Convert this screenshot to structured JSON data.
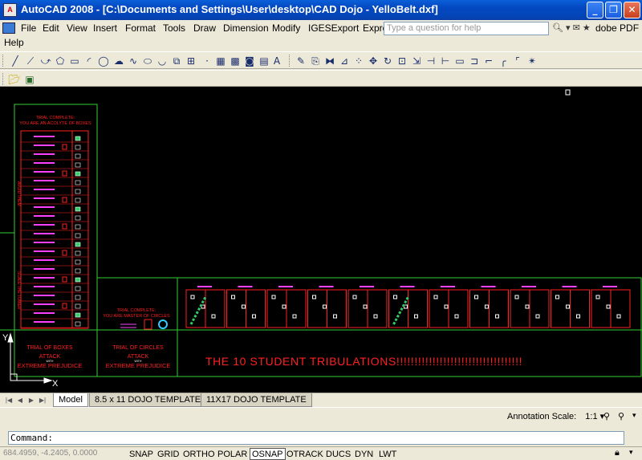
{
  "window": {
    "app_icon": "autocad-icon",
    "title": "AutoCAD 2008 - [C:\\Documents and Settings\\User\\desktop\\CAD Dojo - YelloBelt.dxf]",
    "minimize_icon": "minimize-icon",
    "restore_icon": "restore-icon",
    "close_icon": "close-icon"
  },
  "menu": {
    "items": [
      "File",
      "Edit",
      "View",
      "Insert",
      "Format",
      "Tools",
      "Draw",
      "Dimension",
      "Modify",
      "IGESExport",
      "Expre"
    ],
    "help": "Help",
    "ask_placeholder": "Type a question for help",
    "adobe_pdf": "dobe PDF"
  },
  "canvas": {
    "tribulations": "THE 10 STUDENT TRIBULATIONS!!!!!!!!!!!!!!!!!!!!!!!!!!!!!!!!!!!",
    "trial_boxes_title": "TRIAL COMPLETE:\nYOU ARE AN ACOLYTE OF BOXES",
    "trial_circles_title": "TRIAL COMPLETE:\nYOU ARE MASTER OF CIRCLES",
    "trial_of_boxes": "TRIAL OF BOXES",
    "trial_of_circles": "TRIAL OF CIRCLES",
    "attack": "ATTACK",
    "with": "WITH",
    "extreme_prejudice": "EXTREME PREJUDICE",
    "ucs_x": "X",
    "ucs_y": "Y",
    "side_label_1": "AVOID THEM",
    "side_label_2": "SCALE THE TOWER"
  },
  "layout_tabs": [
    "Model",
    "8.5 x 11 DOJO TEMPLATE",
    "11X17 DOJO TEMPLATE"
  ],
  "annotation": {
    "label": "Annotation Scale:",
    "value": "1:1"
  },
  "command": {
    "prompt": "Command:"
  },
  "status": {
    "coords": "684.4959, -4.2405, 0.0000",
    "buttons": [
      "SNAP",
      "GRID",
      "ORTHO",
      "POLAR",
      "OSNAP",
      "OTRACK",
      "DUCS",
      "DYN",
      "LWT"
    ],
    "active": "OSNAP"
  },
  "colors": {
    "frame_green": "#33cc33",
    "cad_red": "#ff2020",
    "cad_magenta": "#ff40ff",
    "title_blue": "#0a5fd8"
  }
}
